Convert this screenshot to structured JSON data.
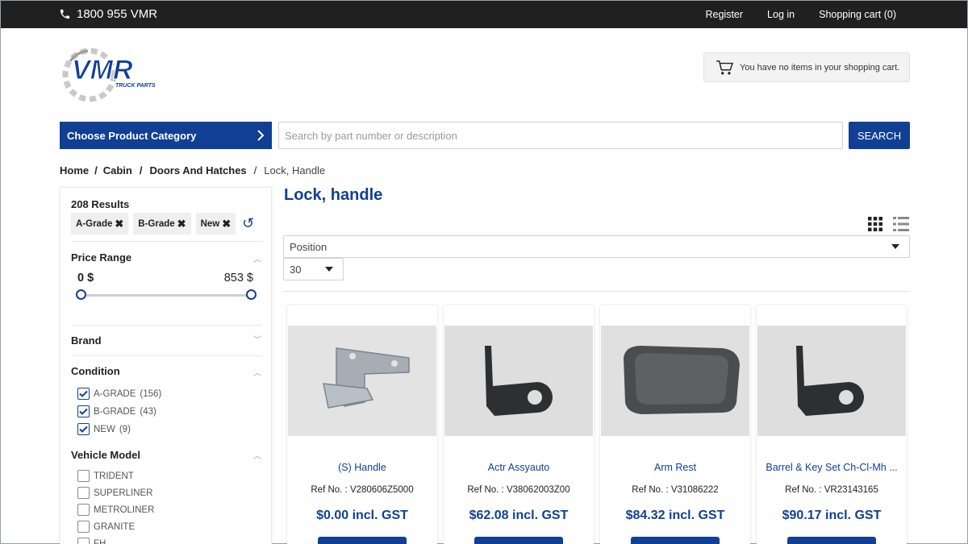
{
  "topbar": {
    "phone": "1800 955 VMR",
    "register": "Register",
    "login": "Log in",
    "cart": "Shopping cart (0)"
  },
  "logo": {
    "main": "VMR",
    "sub": "TRUCK PARTS"
  },
  "cart_box": {
    "text": "You have no items in your shopping cart."
  },
  "category_button": {
    "label": "Choose Product Category"
  },
  "search": {
    "placeholder": "Search by part number or description",
    "button": "SEARCH"
  },
  "breadcrumb": {
    "home": "Home",
    "cabin": "Cabin",
    "doors": "Doors And Hatches",
    "current": "Lock, Handle"
  },
  "filters": {
    "results": "208 Results",
    "chips": [
      "A-Grade",
      "B-Grade",
      "New"
    ],
    "price": {
      "title": "Price Range",
      "min": "0 $",
      "max": "853 $"
    },
    "brand": {
      "title": "Brand"
    },
    "condition": {
      "title": "Condition",
      "options": [
        {
          "label": "A-GRADE",
          "count": "(156)",
          "checked": true
        },
        {
          "label": "B-GRADE",
          "count": "(43)",
          "checked": true
        },
        {
          "label": "NEW",
          "count": "(9)",
          "checked": true
        }
      ]
    },
    "vehicle_model": {
      "title": "Vehicle Model",
      "options": [
        "TRIDENT",
        "SUPERLINER",
        "METROLINER",
        "GRANITE",
        "FH"
      ]
    }
  },
  "main": {
    "title": "Lock, handle",
    "sort": "Position",
    "limit": "30"
  },
  "products": [
    {
      "name": "(S) Handle",
      "ref": "Ref No. : V280606Z5000",
      "price": "$0.00 incl. GST"
    },
    {
      "name": "Actr Assyauto",
      "ref": "Ref No. : V38062003Z00",
      "price": "$62.08 incl. GST"
    },
    {
      "name": "Arm Rest",
      "ref": "Ref No. : V31086222",
      "price": "$84.32 incl. GST"
    },
    {
      "name": "Barrel & Key Set Ch-Cl-Mh ...",
      "ref": "Ref No. : VR23143165",
      "price": "$90.17 incl. GST"
    }
  ],
  "colors": {
    "brand_blue": "#113f94",
    "topbar": "#202020"
  }
}
